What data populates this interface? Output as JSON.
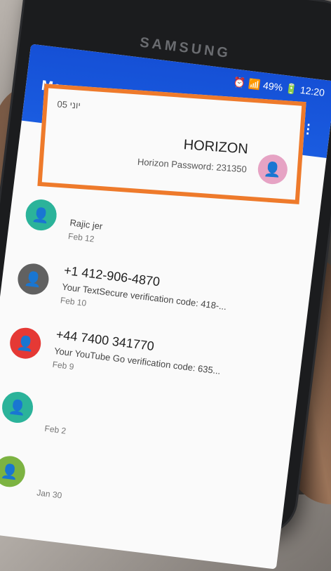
{
  "phone": {
    "brand": "SAMSUNG"
  },
  "status_bar": {
    "text": "⏰ 📶 49% 🔋 12:20"
  },
  "app_bar": {
    "title": "Messages",
    "search_icon": "🔍",
    "more_icon": "⋮"
  },
  "highlighted_message": {
    "date": "05 יוני",
    "sender": "HORIZON",
    "snippet": "Horizon Password: 231350"
  },
  "messages": [
    {
      "sender": "Rajic jer",
      "snippet": "",
      "date": "Feb 12",
      "avatar_color": "#2bb39a"
    },
    {
      "sender": "+1 412-906-4870",
      "snippet": "Your TextSecure verification code: 418-...",
      "date": "Feb 10",
      "avatar_color": "#616161"
    },
    {
      "sender": "+44 7400 341770",
      "snippet": "Your YouTube Go verification code: 635...",
      "date": "Feb 9",
      "avatar_color": "#e53935"
    },
    {
      "sender": "",
      "snippet": "",
      "date": "Feb 2",
      "avatar_color": "#2bb39a"
    },
    {
      "sender": "",
      "snippet": "",
      "date": "Jan 30",
      "avatar_color": "#7cb342"
    }
  ],
  "icons": {
    "person": "👤"
  }
}
